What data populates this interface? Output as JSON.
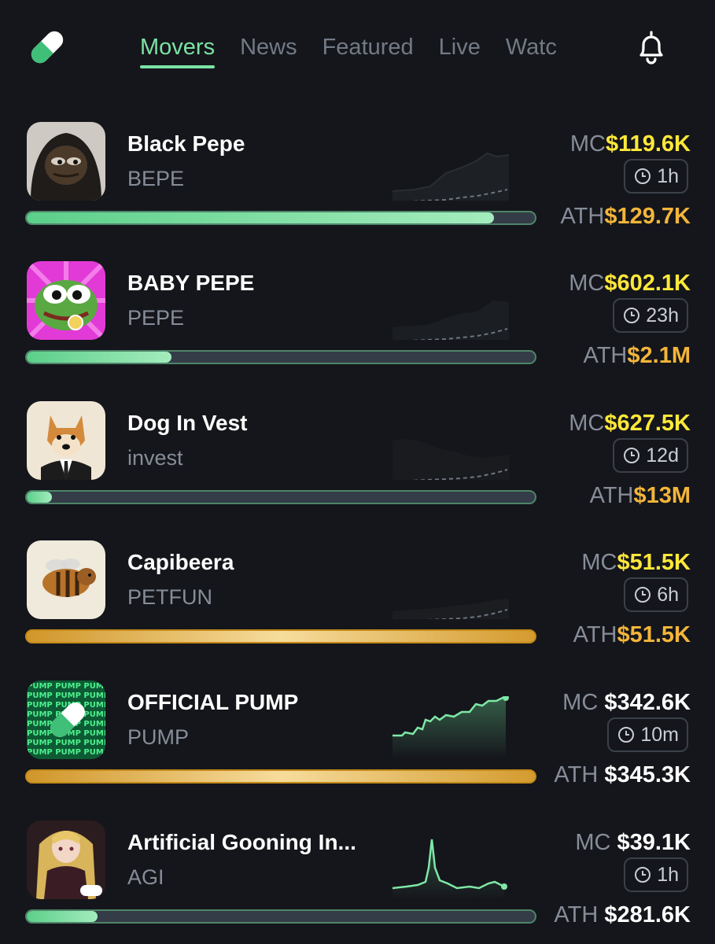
{
  "nav": {
    "tabs": [
      {
        "label": "Movers",
        "active": true
      },
      {
        "label": "News",
        "active": false
      },
      {
        "label": "Featured",
        "active": false
      },
      {
        "label": "Live",
        "active": false
      },
      {
        "label": "Watc",
        "active": false
      }
    ],
    "logo_icon": "pill-icon",
    "bell_icon": "bell-icon"
  },
  "colors": {
    "accent": "#7be3a5",
    "mc_value": "#ffe83a",
    "ath_value": "#f3b53a",
    "progress_fill": "#6ed59a",
    "progress_gold": "#e0ad4a",
    "background": "#15161b"
  },
  "tokens": [
    {
      "name": "Black Pepe",
      "ticker": "BEPE",
      "mc_label": "MC",
      "mc": "$119.6K",
      "age": "1h",
      "ath_label": "ATH",
      "ath": "$129.7K",
      "progress": 0.92,
      "bar_style": "green",
      "value_color": "yellow",
      "ath_color": "orange",
      "spark_style": "dim"
    },
    {
      "name": "BABY PEPE",
      "ticker": "PEPE",
      "mc_label": "MC",
      "mc": "$602.1K",
      "age": "23h",
      "ath_label": "ATH",
      "ath": "$2.1M",
      "progress": 0.285,
      "bar_style": "green",
      "value_color": "yellow",
      "ath_color": "orange",
      "spark_style": "dim"
    },
    {
      "name": "Dog In Vest",
      "ticker": "invest",
      "mc_label": "MC",
      "mc": "$627.5K",
      "age": "12d",
      "ath_label": "ATH",
      "ath": "$13M",
      "progress": 0.05,
      "bar_style": "green",
      "value_color": "yellow",
      "ath_color": "orange",
      "spark_style": "dim"
    },
    {
      "name": "Capibeera",
      "ticker": "PETFUN",
      "mc_label": "MC",
      "mc": "$51.5K",
      "age": "6h",
      "ath_label": "ATH",
      "ath": "$51.5K",
      "progress": 1.0,
      "bar_style": "gold",
      "value_color": "yellow",
      "ath_color": "orange",
      "spark_style": "dim"
    },
    {
      "name": "OFFICIAL PUMP",
      "ticker": "PUMP",
      "mc_label": "MC",
      "mc": "$342.6K",
      "age": "10m",
      "ath_label": "ATH",
      "ath": "$345.3K",
      "progress": 1.0,
      "bar_style": "gold",
      "value_color": "white",
      "ath_color": "white",
      "spark_style": "bright"
    },
    {
      "name": "Artificial Gooning In...",
      "ticker": "AGI",
      "mc_label": "MC",
      "mc": "$39.1K",
      "age": "1h",
      "ath_label": "ATH",
      "ath": "$281.6K",
      "progress": 0.14,
      "bar_style": "green",
      "value_color": "white",
      "ath_color": "white",
      "spark_style": "bright"
    }
  ]
}
